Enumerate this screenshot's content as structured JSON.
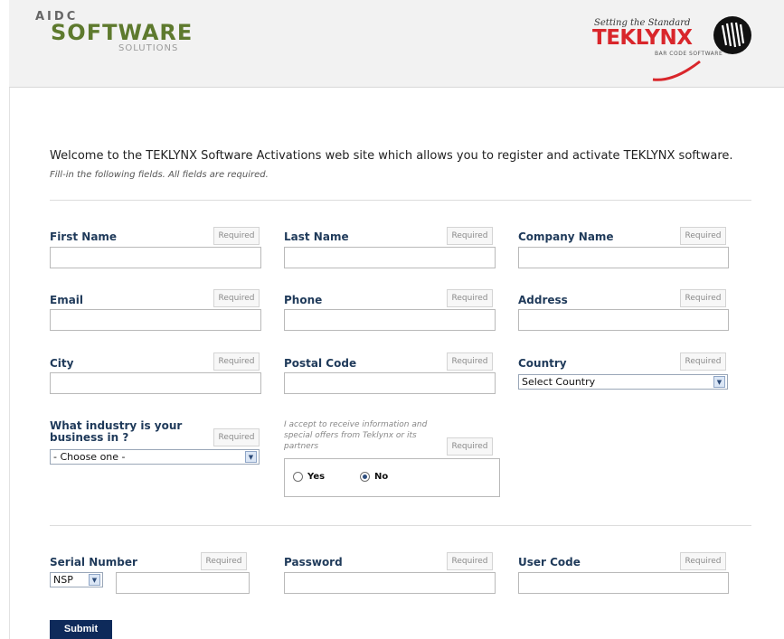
{
  "header": {
    "logo_line1": "AIDC",
    "logo_line2": "SOFTWARE",
    "logo_line3": "SOLUTIONS",
    "brand_tagline": "Setting the Standard",
    "brand_name": "TEKLYNX",
    "brand_sub": "BAR CODE SOFTWARE"
  },
  "intro": {
    "welcome": "Welcome to the TEKLYNX Software Activations web site which allows you to register and activate TEKLYNX software.",
    "instructions": "Fill-in the following fields. All fields are required."
  },
  "required_badge": "Required",
  "fields": {
    "first_name": "First Name",
    "last_name": "Last Name",
    "company_name": "Company Name",
    "email": "Email",
    "phone": "Phone",
    "address": "Address",
    "city": "City",
    "postal_code": "Postal Code",
    "country": "Country",
    "industry_line1": "What industry is your",
    "industry_line2": "business in ?",
    "serial_number": "Serial Number",
    "password": "Password",
    "user_code": "User Code"
  },
  "selects": {
    "country": "Select Country",
    "industry": "- Choose one -",
    "serial_prefix": "NSP"
  },
  "offers": {
    "text": "I accept to receive information and special offers from Teklynx or its partners",
    "yes": "Yes",
    "no": "No",
    "selected": "No"
  },
  "submit_label": "Submit",
  "colors": {
    "label": "#1f3a5a",
    "brand_red": "#d9262b",
    "logo_green": "#5e7a2e",
    "submit_bg": "#0e2a5a"
  }
}
